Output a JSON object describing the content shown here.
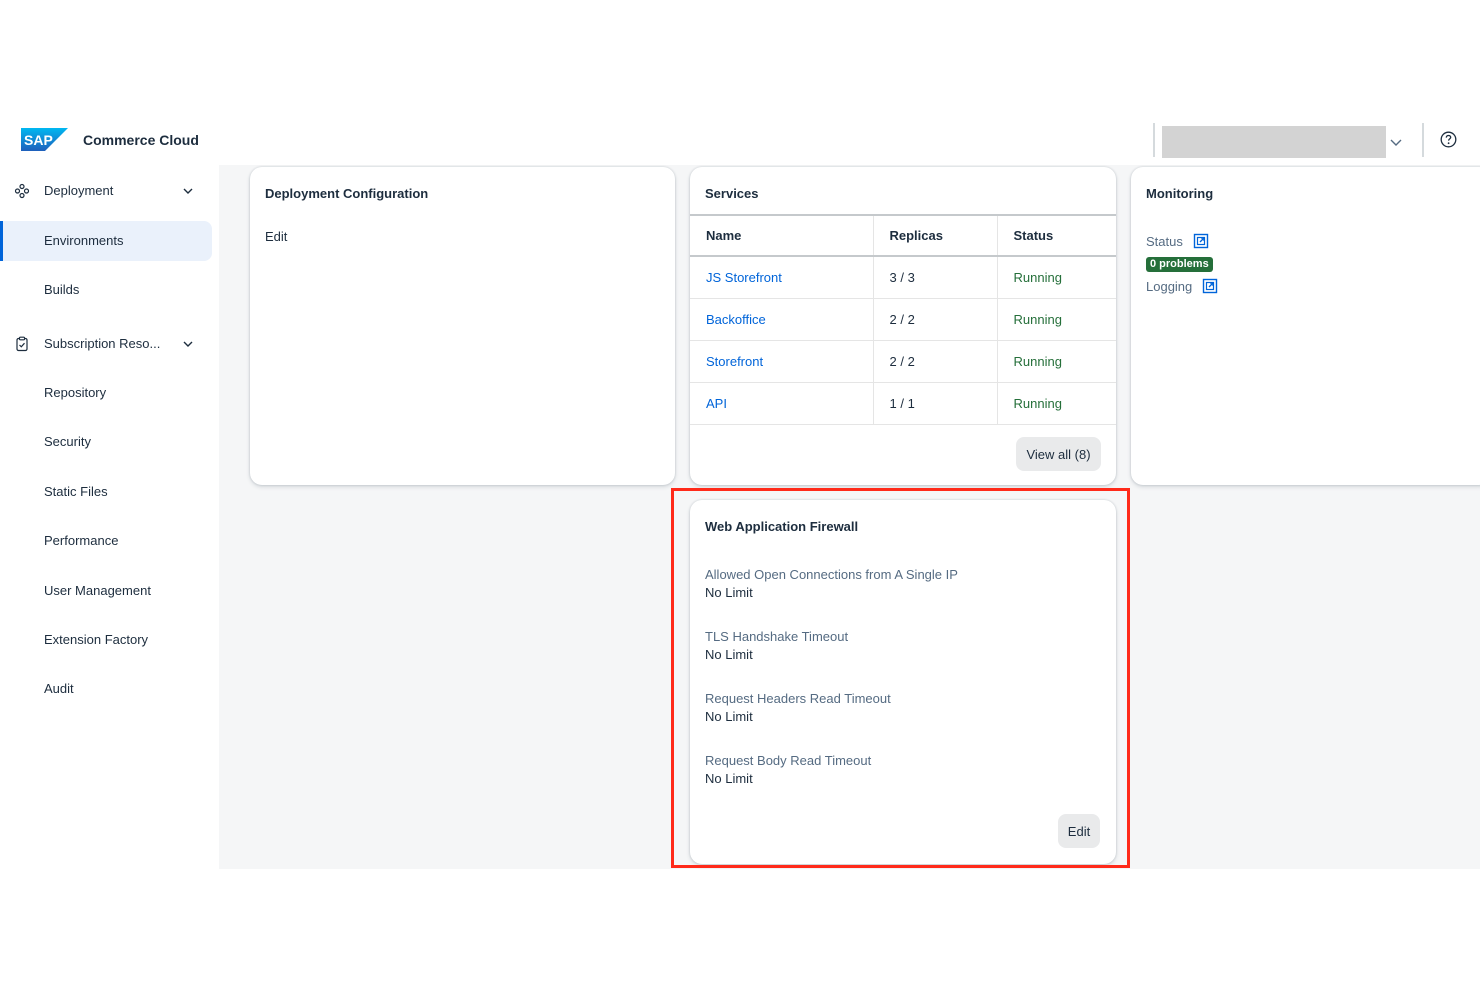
{
  "header": {
    "product_name": "Commerce Cloud",
    "logo_icon": "sap-logo",
    "help_icon": "question-circle-icon"
  },
  "sidebar": {
    "items": [
      {
        "label": "Deployment",
        "icon": "deployment-icon",
        "expandable": true
      },
      {
        "label": "Environments",
        "selected": true
      },
      {
        "label": "Builds"
      },
      {
        "label": "Subscription Reso...",
        "icon": "clipboard-check-icon",
        "expandable": true
      },
      {
        "label": "Repository"
      },
      {
        "label": "Security"
      },
      {
        "label": "Static Files"
      },
      {
        "label": "Performance"
      },
      {
        "label": "User Management"
      },
      {
        "label": "Extension Factory"
      },
      {
        "label": "Audit"
      }
    ]
  },
  "deployment_config": {
    "title": "Deployment Configuration",
    "edit_label": "Edit"
  },
  "services": {
    "title": "Services",
    "columns": [
      "Name",
      "Replicas",
      "Status"
    ],
    "rows": [
      {
        "name": "JS Storefront",
        "replicas": "3 / 3",
        "status": "Running"
      },
      {
        "name": "Backoffice",
        "replicas": "2 / 2",
        "status": "Running"
      },
      {
        "name": "Storefront",
        "replicas": "2 / 2",
        "status": "Running"
      },
      {
        "name": "API",
        "replicas": "1 / 1",
        "status": "Running"
      }
    ],
    "view_all_label": "View all (8)"
  },
  "monitoring": {
    "title": "Monitoring",
    "status_label": "Status",
    "problems_badge": "0 problems",
    "logging_label": "Logging",
    "external_link_icon": "external-link-icon"
  },
  "waf": {
    "title": "Web Application Firewall",
    "fields": [
      {
        "label": "Allowed Open Connections from A Single IP",
        "value": "No Limit"
      },
      {
        "label": "TLS Handshake Timeout",
        "value": "No Limit"
      },
      {
        "label": "Request Headers Read Timeout",
        "value": "No Limit"
      },
      {
        "label": "Request Body Read Timeout",
        "value": "No Limit"
      }
    ],
    "edit_label": "Edit"
  },
  "colors": {
    "accent": "#0064d9",
    "running": "#256f3a",
    "highlight": "#ff2a1a",
    "content_bg": "#f5f6f7"
  }
}
